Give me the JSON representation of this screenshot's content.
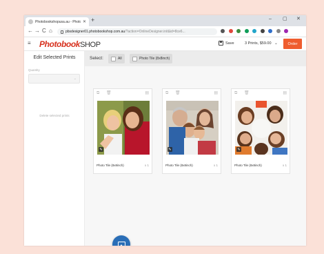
{
  "browser": {
    "tab_title": "Photobookshopusa.au - Photo",
    "tab_close": "✕",
    "new_tab": "+",
    "window_controls": {
      "minimize": "–",
      "maximize": "▢",
      "close": "✕"
    },
    "nav": {
      "back": "←",
      "forward": "→",
      "reload": "C",
      "home": "⌂"
    },
    "url_host": "pbsdesigner01.photobookshop.com.au",
    "url_path": "/?action=OnlineDesigner.init&id=8ce6...",
    "extension_colors": [
      "#555555",
      "#e0473b",
      "#3c8c3c",
      "#0f9d58",
      "#22a5c9",
      "#444444",
      "#2e6ec9",
      "#888888",
      "#9c27b0"
    ]
  },
  "app": {
    "logo_part1": "Photobook",
    "logo_part2": "SHOP",
    "menu_icon": "≡",
    "save_label": "Save",
    "cart_summary": "3 Prints, $59.00",
    "cart_chevron": "⌄",
    "order_label": "Order",
    "accent_color": "#ef5d2f",
    "brand_color": "#d7321f"
  },
  "sidebar": {
    "title": "Edit Selected Prints",
    "quantity_label": "Quantity",
    "quantity_chevron": "⌄",
    "delete_label": "Delete selected prints"
  },
  "selectbar": {
    "label": "Select:",
    "chips": [
      {
        "label": "All"
      },
      {
        "label": "Photo Tile (8x8inch)"
      }
    ]
  },
  "cards": [
    {
      "name": "Photo Tile (8x8inch)",
      "qty": "x 1",
      "tools": {
        "duplicate": "⧉",
        "delete": "🗑",
        "layout": "▤"
      },
      "edit": "✎"
    },
    {
      "name": "Photo Tile (8x8inch)",
      "qty": "x 1",
      "tools": {
        "duplicate": "⧉",
        "delete": "🗑",
        "layout": "▤"
      },
      "edit": "✎"
    },
    {
      "name": "Photo Tile (8x8inch)",
      "qty": "x 1",
      "tools": {
        "duplicate": "⧉",
        "delete": "🗑",
        "layout": "▤"
      },
      "edit": "✎"
    }
  ]
}
